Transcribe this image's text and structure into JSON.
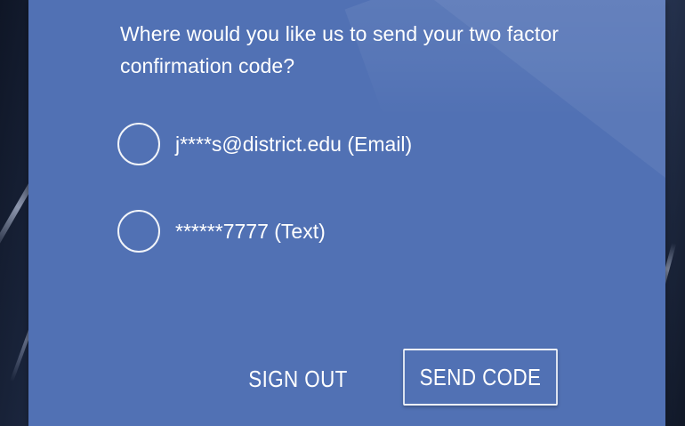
{
  "prompt": {
    "question": "Where would you like us to send your two factor confirmation code?"
  },
  "options": [
    {
      "label": "j****s@district.edu (Email)",
      "selected": false
    },
    {
      "label": "******7777 (Text)",
      "selected": false
    }
  ],
  "actions": {
    "sign_out_label": "SIGN OUT",
    "send_code_label": "SEND CODE"
  },
  "colors": {
    "card_background": "#5171b4",
    "text": "#ffffff"
  }
}
